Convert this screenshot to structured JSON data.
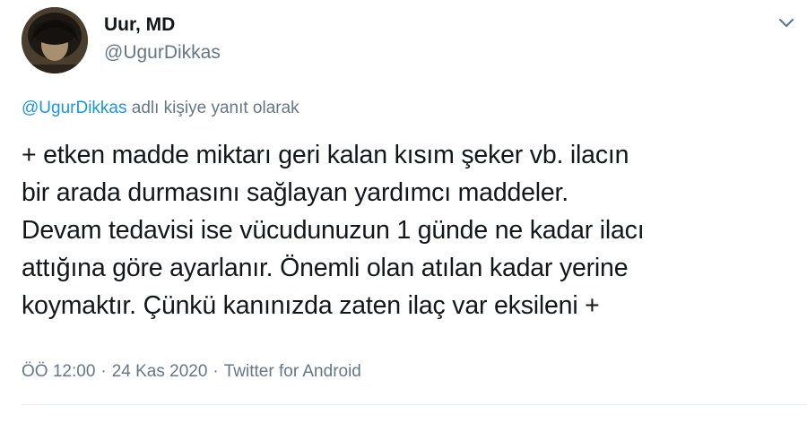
{
  "author": {
    "name": "Uur, MD",
    "handle": "@UgurDikkas"
  },
  "icons": {
    "avatar": "profile-photo",
    "menu": "chevron-down-icon"
  },
  "reply": {
    "mention": "@UgurDikkas",
    "suffix": " adlı kişiye yanıt olarak"
  },
  "tweet": {
    "lines": [
      "+ etken madde miktarı geri kalan kısım şeker vb. ilacın",
      "bir arada durmasını sağlayan yardımcı maddeler.",
      "Devam tedavisi ise vücudunuzun 1 günde ne kadar ilacı",
      "attığına göre ayarlanır. Önemli olan atılan kadar yerine",
      "koymaktır. Çünkü kanınızda zaten ilaç var eksileni +"
    ]
  },
  "meta": {
    "time": "ÖÖ 12:00",
    "separator": "·",
    "date": "24 Kas 2020",
    "source": "Twitter for Android"
  },
  "colors": {
    "text": "#14171a",
    "secondary": "#657786",
    "link": "#1b95e0"
  }
}
